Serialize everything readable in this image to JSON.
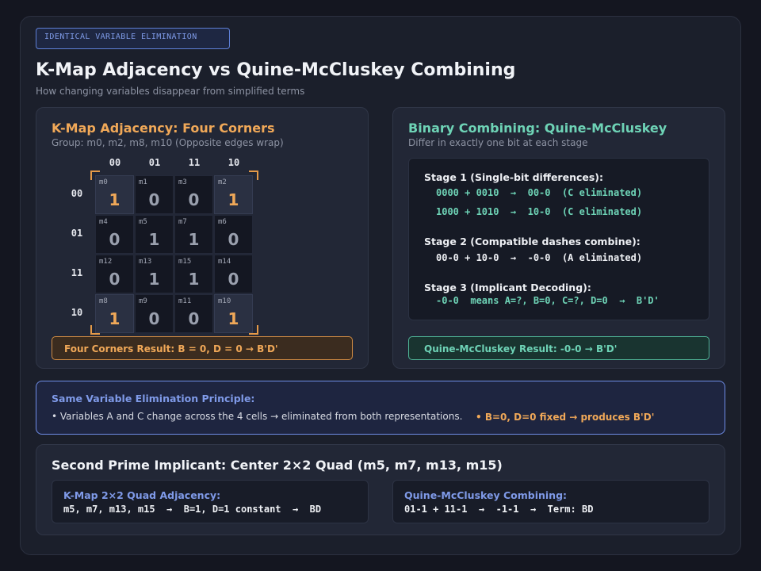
{
  "header": {
    "tag": "IDENTICAL VARIABLE ELIMINATION",
    "title": "K-Map Adjacency vs Quine-McCluskey Combining",
    "subtitle": "How changing variables disappear from simplified terms"
  },
  "kmap_card": {
    "title": "K-Map Adjacency: Four Corners",
    "subtitle": "Group: m0, m2, m8, m10 (Opposite edges wrap)",
    "col_headers": [
      "00",
      "01",
      "11",
      "10"
    ],
    "row_headers": [
      "00",
      "01",
      "11",
      "10"
    ],
    "cells": [
      [
        {
          "label": "m0",
          "value": "1",
          "highlight": true
        },
        {
          "label": "m1",
          "value": "0"
        },
        {
          "label": "m3",
          "value": "0"
        },
        {
          "label": "m2",
          "value": "1",
          "highlight": true
        }
      ],
      [
        {
          "label": "m4",
          "value": "0"
        },
        {
          "label": "m5",
          "value": "1"
        },
        {
          "label": "m7",
          "value": "1"
        },
        {
          "label": "m6",
          "value": "0"
        }
      ],
      [
        {
          "label": "m12",
          "value": "0"
        },
        {
          "label": "m13",
          "value": "1"
        },
        {
          "label": "m15",
          "value": "1"
        },
        {
          "label": "m14",
          "value": "0"
        }
      ],
      [
        {
          "label": "m8",
          "value": "1",
          "highlight": true
        },
        {
          "label": "m9",
          "value": "0"
        },
        {
          "label": "m11",
          "value": "0"
        },
        {
          "label": "m10",
          "value": "1",
          "highlight": true
        }
      ]
    ],
    "result": "Four Corners Result: B = 0, D = 0  →  B'D'"
  },
  "qm_card": {
    "title": "Binary Combining: Quine-McCluskey",
    "subtitle": "Differ in exactly one bit at each stage",
    "stage1_title": "Stage 1 (Single-bit differences):",
    "stage1_line1": "0000 + 0010  →  00-0  (C eliminated)",
    "stage1_line2": "1000 + 1010  →  10-0  (C eliminated)",
    "stage2_title": "Stage 2 (Compatible dashes combine):",
    "stage2_line": "00-0 + 10-0  →  -0-0  (A eliminated)",
    "stage3_title": "Stage 3 (Implicant Decoding):",
    "stage3_line": "-0-0  means A=?, B=0, C=?, D=0  →  B'D'",
    "result": "Quine-McCluskey Result: -0-0  →  B'D'"
  },
  "principle": {
    "title": "Same Variable Elimination Principle:",
    "left_text": "• Variables A and C change across the 4 cells  →  eliminated from both representations.",
    "right_text": "• B=0, D=0 fixed  →  produces B'D'"
  },
  "second": {
    "title": "Second Prime Implicant: Center 2×2 Quad (m5, m7, m13, m15)",
    "kmap_title": "K-Map 2×2 Quad Adjacency:",
    "kmap_line": "m5, m7, m13, m15  →  B=1, D=1 constant  →  BD",
    "qm_title": "Quine-McCluskey Combining:",
    "qm_line": "01-1 + 11-1  →  -1-1  →  Term: BD"
  },
  "colors": {
    "orange": "#f0a858",
    "teal": "#6ed3b6",
    "blue": "#7f9ae8",
    "background": "#141620"
  }
}
